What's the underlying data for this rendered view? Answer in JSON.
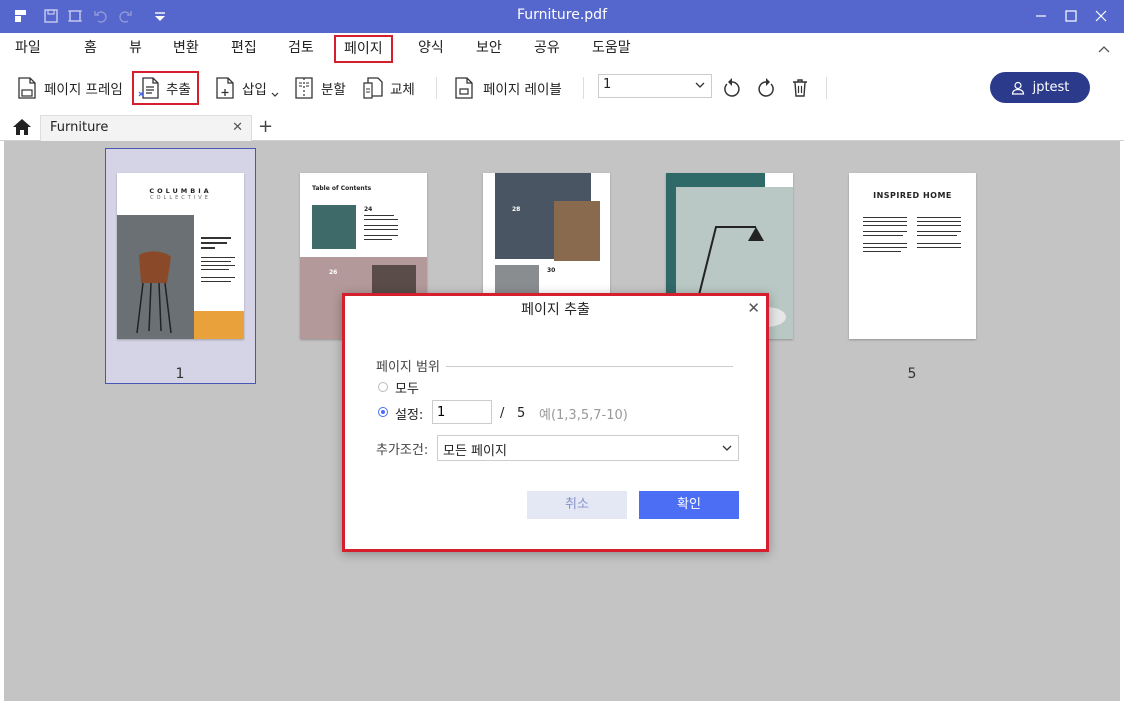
{
  "window": {
    "title": "Furniture.pdf"
  },
  "menu": {
    "items": [
      "파일",
      "홈",
      "뷰",
      "변환",
      "편집",
      "검토",
      "페이지",
      "양식",
      "보안",
      "공유",
      "도움말"
    ],
    "active": "페이지"
  },
  "toolbar": {
    "page_frame": "페이지 프레임",
    "extract": "추출",
    "insert": "삽입",
    "split": "분할",
    "replace": "교체",
    "page_label": "페이지 레이블",
    "page_select_value": "1",
    "user_name": "jptest"
  },
  "tabs": {
    "doc_tab": "Furniture"
  },
  "thumbnails": {
    "page_numbers": [
      "1",
      "5"
    ],
    "page1": {
      "brand": "COLUMBIA",
      "sub": "COLLECTIVE"
    },
    "page2": {
      "title": "Table of Contents",
      "n1": "24",
      "n2": "26"
    },
    "page3": {
      "n1": "28",
      "n2": "30"
    },
    "page5": {
      "title": "INSPIRED HOME"
    }
  },
  "dialog": {
    "title": "페이지 추출",
    "range_group": "페이지 범위",
    "option_all": "모두",
    "option_set": "설정:",
    "range_value": "1",
    "total_separator": "/",
    "total_pages": "5",
    "example": "예(1,3,5,7-10)",
    "extra_label": "추가조건:",
    "extra_value": "모든 페이지",
    "cancel": "취소",
    "ok": "확인"
  },
  "colors": {
    "titlebar": "#5566cc",
    "accent": "#4c6ef5",
    "highlight": "#d61f2c",
    "user_button": "#2b3a8a"
  }
}
